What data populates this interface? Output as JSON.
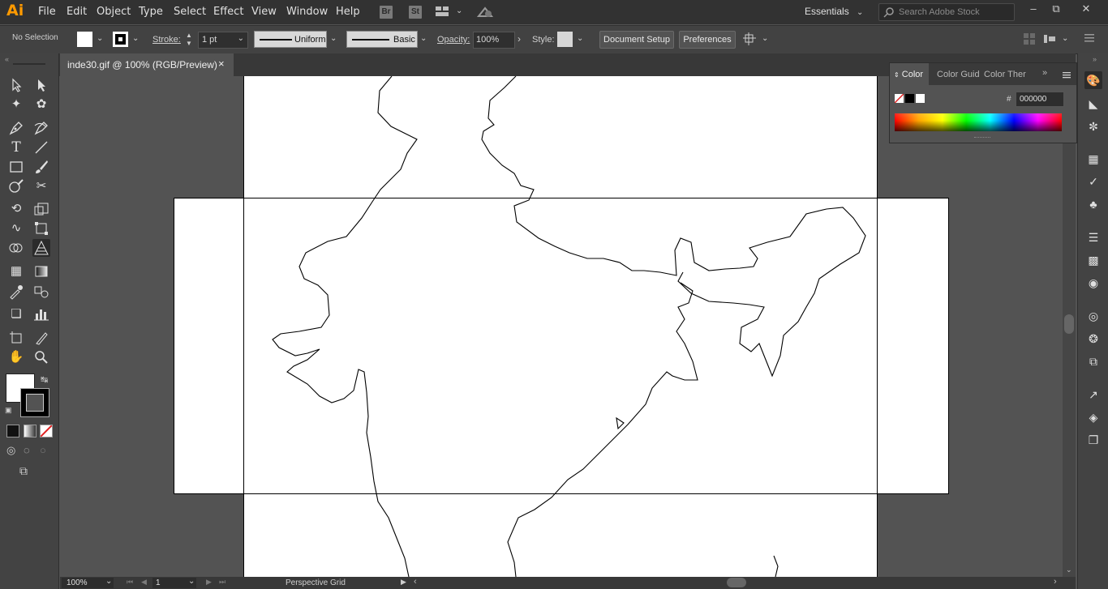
{
  "app": {
    "logo_text": "Ai"
  },
  "menubar": {
    "items": [
      "File",
      "Edit",
      "Object",
      "Type",
      "Select",
      "Effect",
      "View",
      "Window",
      "Help"
    ],
    "bridge_label": "Br",
    "stock_label": "St",
    "workspace": "Essentials",
    "search_placeholder": "Search Adobe Stock"
  },
  "control_bar": {
    "selection_status": "No Selection",
    "stroke_label": "Stroke:",
    "stroke_weight": "1 pt",
    "profile_uniform": "Uniform",
    "brush_basic": "Basic",
    "opacity_label": "Opacity:",
    "opacity_value": "100%",
    "style_label": "Style:",
    "document_setup": "Document Setup",
    "preferences": "Preferences"
  },
  "document_tab": {
    "title": "inde30.gif @ 100% (RGB/Preview)",
    "close_glyph": "×"
  },
  "color_panel": {
    "tabs": [
      "Color",
      "Color Guid",
      "Color Ther"
    ],
    "hex_label": "#",
    "hex_value": "000000"
  },
  "status_bar": {
    "zoom": "100%",
    "page": "1",
    "tool_name": "Perspective Grid"
  },
  "colors": {
    "app_bg": "#535353",
    "menubar_bg": "#323232",
    "panel_bg": "#424242",
    "accent_logo": "#ff9a00",
    "artboard": "#ffffff"
  },
  "icons": {
    "tools": [
      "selection-icon",
      "direct-selection-icon",
      "magic-wand-icon",
      "lasso-icon",
      "pen-icon",
      "curvature-icon",
      "type-icon",
      "line-icon",
      "rectangle-icon",
      "paintbrush-icon",
      "shaper-icon",
      "scissors-icon",
      "rotate-icon",
      "scale-icon",
      "width-icon",
      "free-transform-icon",
      "shape-builder-icon",
      "perspective-grid-icon",
      "mesh-icon",
      "gradient-icon",
      "eyedropper-icon",
      "blend-icon",
      "symbol-sprayer-icon",
      "column-graph-icon",
      "artboard-icon",
      "slice-icon",
      "hand-icon",
      "zoom-icon"
    ]
  }
}
